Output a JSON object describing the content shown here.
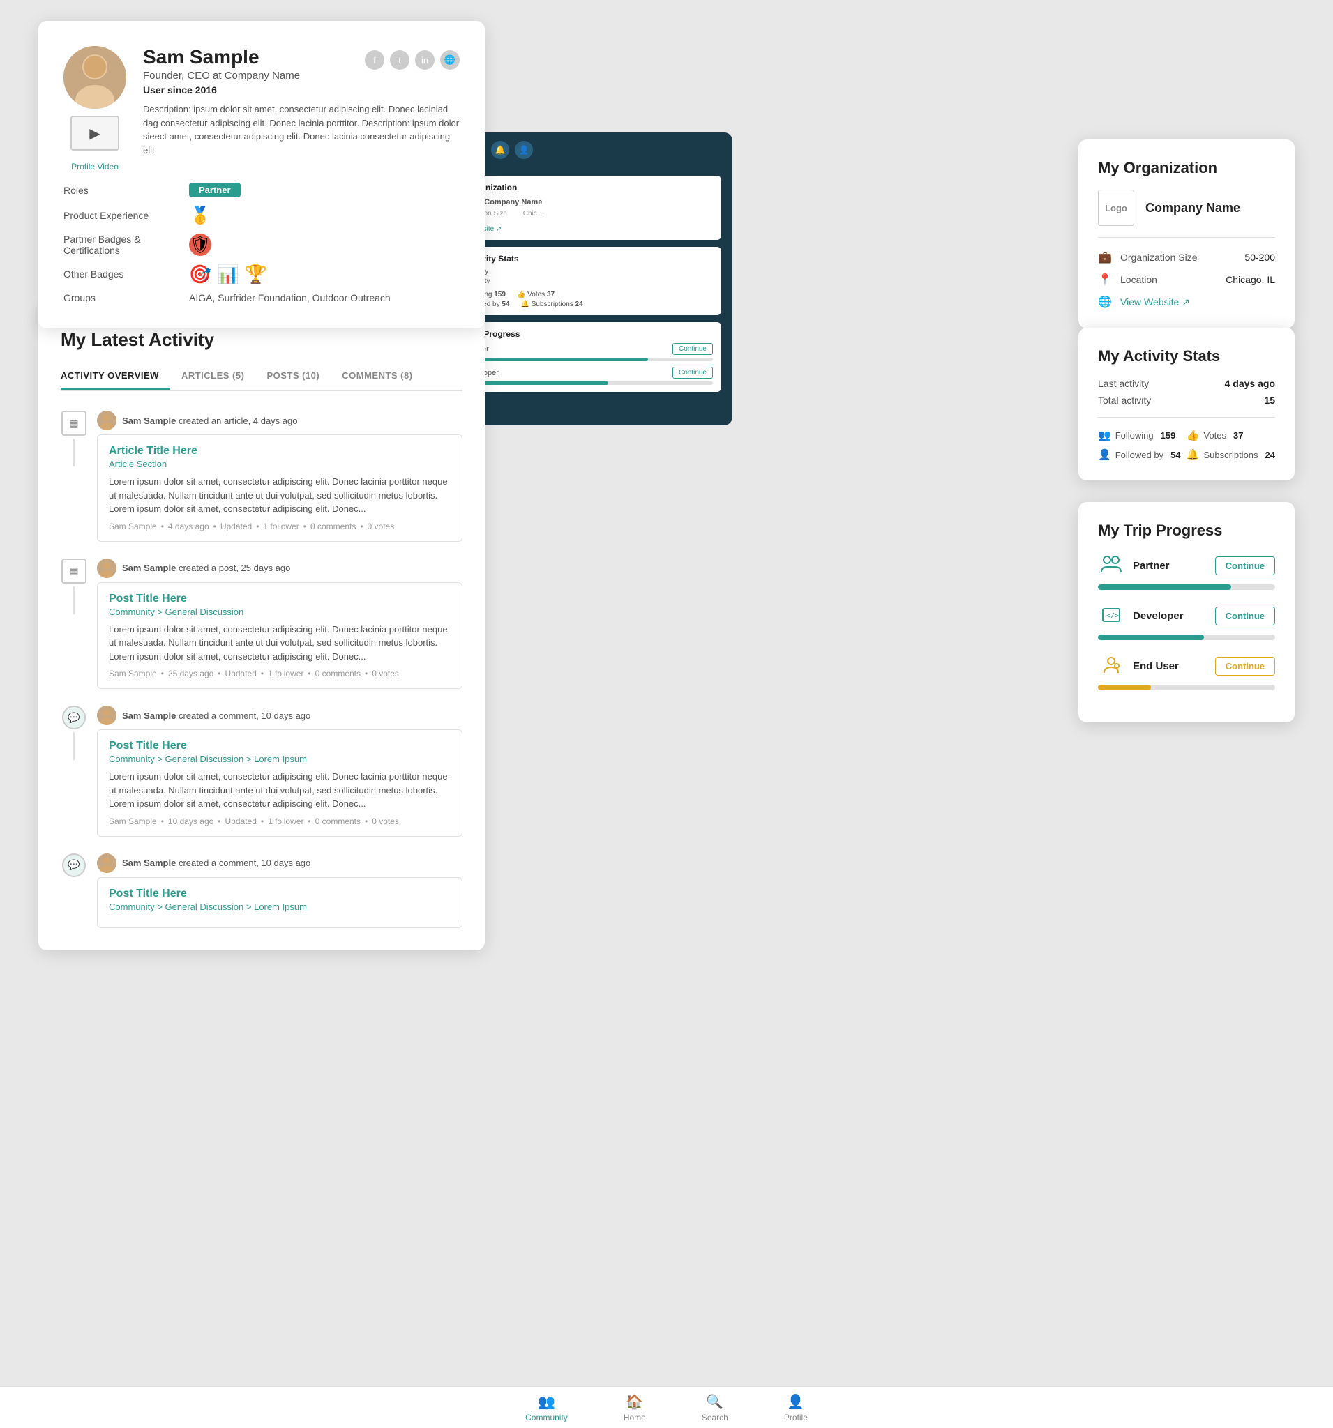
{
  "profile": {
    "name": "Sam Sample",
    "title": "Founder, CEO at Company Name",
    "since_label": "User since",
    "since_year": "2016",
    "description": "Description: ipsum dolor sit amet, consectetur adipiscing elit. Donec laciniad dag consectetur adipiscing elit. Donec lacinia porttitor. Description: ipsum dolor sieect amet, consectetur adipiscing elit. Donec lacinia consectetur adipiscing elit.",
    "video_label": "Profile Video",
    "roles_label": "Roles",
    "roles_value": "Partner",
    "product_exp_label": "Product Experience",
    "partner_badges_label": "Partner Badges & Certifications",
    "other_badges_label": "Other Badges",
    "groups_label": "Groups",
    "groups_value": "AIGA, Surfrider Foundation, Outdoor Outreach"
  },
  "social": {
    "facebook": "f",
    "twitter": "t",
    "linkedin": "in",
    "globe": "🌐"
  },
  "activity": {
    "title": "My Latest Activity",
    "tabs": [
      {
        "label": "ACTIVITY OVERVIEW",
        "active": true
      },
      {
        "label": "ARTICLES (5)",
        "active": false
      },
      {
        "label": "POSTS (10)",
        "active": false
      },
      {
        "label": "COMMENTS (8)",
        "active": false
      }
    ],
    "items": [
      {
        "type": "article",
        "user": "Sam Sample",
        "action": "created an article, 4 days ago",
        "card_title": "Article Title Here",
        "card_section": "Article Section",
        "card_body": "Lorem ipsum dolor sit amet, consectetur adipiscing elit. Donec lacinia porttitor neque ut malesuada. Nullam tincidunt ante ut dui volutpat, sed sollicitudin metus lobortis. Lorem ipsum dolor sit amet, consectetur adipiscing elit. Donec...",
        "meta": "Sam Sample  •  4 days ago  •  Updated  •  1 follower  •  0 comments  •  0 votes"
      },
      {
        "type": "post",
        "user": "Sam Sample",
        "action": "created a post, 25 days ago",
        "card_title": "Post Title Here",
        "card_breadcrumb": "Community > General Discussion",
        "card_body": "Lorem ipsum dolor sit amet, consectetur adipiscing elit. Donec lacinia porttitor neque ut malesuada. Nullam tincidunt ante ut dui volutpat, sed sollicitudin metus lobortis. Lorem ipsum dolor sit amet, consectetur adipiscing elit. Donec...",
        "meta": "Sam Sample  •  25 days ago  •  Updated  •  1 follower  •  0 comments  •  0 votes"
      },
      {
        "type": "comment",
        "user": "Sam Sample",
        "action": "created a comment, 10 days ago",
        "card_title": "Post Title Here",
        "card_breadcrumb": "Community > General Discussion > Lorem Ipsum",
        "card_body": "Lorem ipsum dolor sit amet, consectetur adipiscing elit. Donec lacinia porttitor neque ut malesuada. Nullam tincidunt ante ut dui volutpat, sed sollicitudin metus lobortis. Lorem ipsum dolor sit amet, consectetur adipiscing elit. Donec...",
        "meta": "Sam Sample  •  10 days ago  •  Updated  •  1 follower  •  0 comments  •  0 votes"
      },
      {
        "type": "comment",
        "user": "Sam Sample",
        "action": "created a comment, 10 days ago",
        "card_title": "Post Title Here",
        "card_breadcrumb": "Community > General Discussion > Lorem Ipsum",
        "card_body": "",
        "meta": ""
      }
    ]
  },
  "organization": {
    "section_title": "My Organization",
    "logo_label": "Logo",
    "company_name": "Company Name",
    "org_size_label": "Organization Size",
    "org_size_value": "50-200",
    "location_label": "Location",
    "location_value": "Chicago, IL",
    "website_label": "View Website",
    "website_icon": "↗"
  },
  "activity_stats": {
    "section_title": "My Activity Stats",
    "last_activity_label": "Last activity",
    "last_activity_value": "4 days ago",
    "total_activity_label": "Total activity",
    "total_activity_value": "15",
    "following_label": "Following",
    "following_value": "159",
    "followed_label": "Followed by",
    "followed_value": "54",
    "votes_label": "Votes",
    "votes_value": "37",
    "subscriptions_label": "Subscriptions",
    "subscriptions_value": "24"
  },
  "trip_progress": {
    "section_title": "My Trip Progress",
    "items": [
      {
        "label": "Partner",
        "progress": 75,
        "color": "teal",
        "btn_color": "teal",
        "btn_label": "Continue"
      },
      {
        "label": "Developer",
        "progress": 60,
        "color": "teal",
        "btn_color": "teal",
        "btn_label": "Continue"
      },
      {
        "label": "End User",
        "progress": 30,
        "color": "yellow",
        "btn_color": "yellow",
        "btn_label": "Continue"
      }
    ]
  },
  "bottom_nav": {
    "items": [
      {
        "label": "Community",
        "icon": "👥",
        "active": true
      },
      {
        "label": "Home",
        "icon": "🏠",
        "active": false
      },
      {
        "label": "Search",
        "icon": "🔍",
        "active": false
      },
      {
        "label": "Profile",
        "icon": "👤",
        "active": false
      }
    ]
  }
}
